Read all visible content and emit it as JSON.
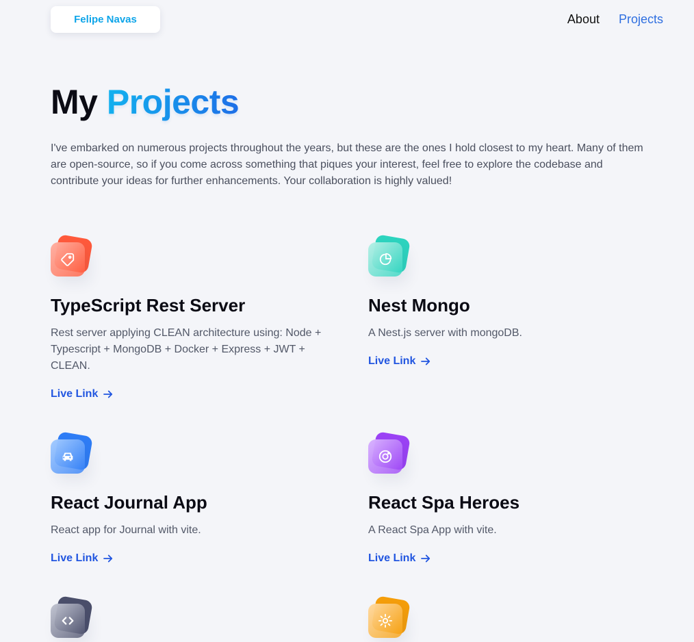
{
  "header": {
    "logo_label": "Felipe Navas",
    "nav": [
      {
        "label": "About",
        "active": false
      },
      {
        "label": "Projects",
        "active": true
      }
    ]
  },
  "page": {
    "title_prefix": "My",
    "title_accent": "Projects",
    "intro": "I've embarked on numerous projects throughout the years, but these are the ones I hold closest to my heart. Many of them are open-source, so if you come across something that piques your interest, feel free to explore the codebase and contribute your ideas for further enhancements. Your collaboration is highly valued!"
  },
  "projects": [
    {
      "title": "TypeScript Rest Server",
      "description": "Rest server applying CLEAN architecture using: Node + Typescript + MongoDB + Docker + Express + JWT + CLEAN.",
      "link_label": "Live Link",
      "icon": "tag-icon",
      "colors": {
        "back": "#ff5a3c",
        "front": "#ffb1a3"
      }
    },
    {
      "title": "Nest Mongo",
      "description": "A Nest.js server with mongoDB.",
      "link_label": "Live Link",
      "icon": "chart-pie-icon",
      "colors": {
        "back": "#2dd4bf",
        "front": "#b7f0e6"
      }
    },
    {
      "title": "React Journal App",
      "description": "React app for Journal with vite.",
      "link_label": "Live Link",
      "icon": "car-icon",
      "colors": {
        "back": "#2f7df6",
        "front": "#a5ccff"
      }
    },
    {
      "title": "React Spa Heroes",
      "description": "A React Spa App with vite.",
      "link_label": "Live Link",
      "icon": "instagram-icon",
      "colors": {
        "back": "#9b42f5",
        "front": "#d9b4ff"
      }
    },
    {
      "title": "",
      "description": "",
      "link_label": "",
      "icon": "code-icon",
      "colors": {
        "back": "#4b4f6b",
        "front": "#c2c5d2"
      }
    },
    {
      "title": "",
      "description": "",
      "link_label": "",
      "icon": "gear-icon",
      "colors": {
        "back": "#f59e0b",
        "front": "#ffd9a0"
      }
    }
  ]
}
